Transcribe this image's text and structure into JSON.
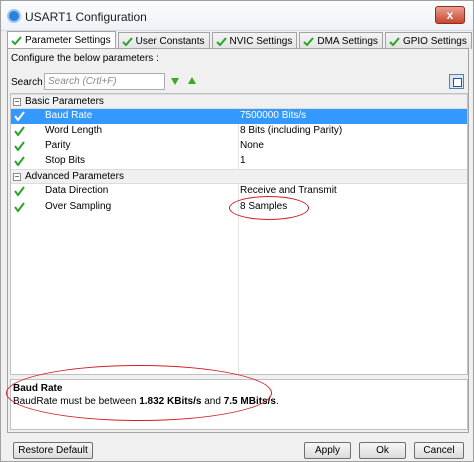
{
  "window": {
    "title": "USART1 Configuration",
    "close_glyph": "x"
  },
  "tabs": [
    {
      "label": "Parameter Settings",
      "active": true
    },
    {
      "label": "User Constants",
      "active": false
    },
    {
      "label": "NVIC Settings",
      "active": false
    },
    {
      "label": "DMA Settings",
      "active": false
    },
    {
      "label": "GPIO Settings",
      "active": false
    }
  ],
  "panel": {
    "configure_label": "Configure the below parameters :",
    "search_label": "Search :",
    "search_placeholder": "Search (Crtl+F)"
  },
  "groups": [
    {
      "name": "Basic Parameters",
      "toggle": "−",
      "params": [
        {
          "name": "Baud Rate",
          "value": "7500000 Bits/s"
        },
        {
          "name": "Word Length",
          "value": "8 Bits (including Parity)"
        },
        {
          "name": "Parity",
          "value": "None"
        },
        {
          "name": "Stop Bits",
          "value": "1"
        }
      ]
    },
    {
      "name": "Advanced Parameters",
      "toggle": "−",
      "params": [
        {
          "name": "Data Direction",
          "value": "Receive and Transmit"
        },
        {
          "name": "Over Sampling",
          "value": "8 Samples"
        }
      ]
    }
  ],
  "description": {
    "title": "Baud Rate",
    "text_prefix": "BaudRate must be between ",
    "min": "1.832 KBits/s",
    "and": " and ",
    "max": "7.5 MBits/s",
    "suffix": "."
  },
  "buttons": {
    "restore_default": "Restore Default",
    "apply": "Apply",
    "ok": "Ok",
    "cancel": "Cancel"
  },
  "colors": {
    "selection": "#3399ff",
    "annotation": "#d21f1f",
    "check_green": "#2aa52a",
    "arrow_green": "#3caa1e"
  },
  "icons": {
    "tab_check": "green-check-icon",
    "find_next": "arrow-down-icon",
    "find_prev": "arrow-up-icon",
    "expand_all": "expand-grid-icon"
  }
}
